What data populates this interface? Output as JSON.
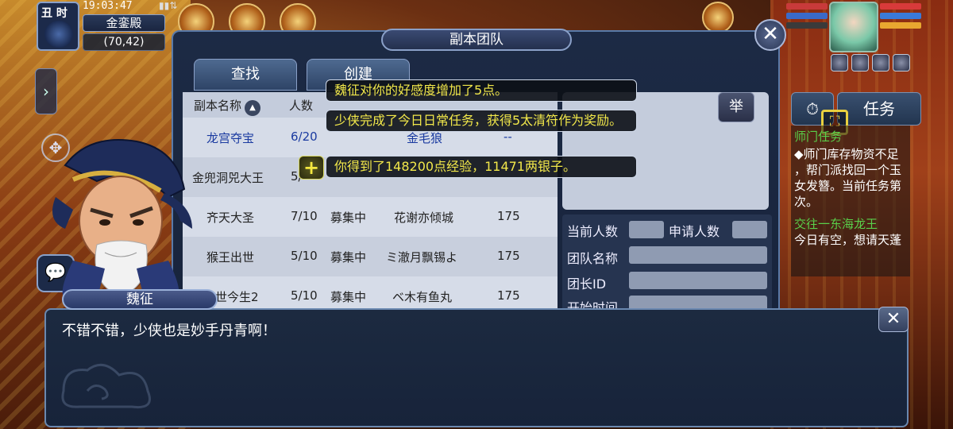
{
  "status": {
    "shichen": "丑 时",
    "clock": "19:03:47",
    "map_name": "金銮殿",
    "coords": "(70,42)"
  },
  "panel": {
    "title": "副本团队",
    "close": "✕",
    "tabs": [
      "查找",
      "创建"
    ],
    "raise_label": "举"
  },
  "table": {
    "headers": [
      "副本名称",
      "人数"
    ],
    "rows": [
      {
        "name": "龙宫夺宝",
        "count": "6/20",
        "status": "",
        "leader": "金毛狼",
        "level": "--"
      },
      {
        "name": "金兜洞兕大王",
        "count": "5/",
        "status": "",
        "leader": "",
        "level": ""
      },
      {
        "name": "齐天大圣",
        "count": "7/10",
        "status": "募集中",
        "leader": "花谢亦倾城",
        "level": "175"
      },
      {
        "name": "猴王出世",
        "count": "5/10",
        "status": "募集中",
        "leader": "ミ澈月飘锡よ",
        "level": "175"
      },
      {
        "name": "前世今生2",
        "count": "5/10",
        "status": "募集中",
        "leader": "ベ木有鱼丸",
        "level": "175"
      }
    ]
  },
  "info": {
    "current_count": "当前人数",
    "apply_count": "申请人数",
    "team_name": "团队名称",
    "leader_id": "团长ID",
    "start_time": "开始时间"
  },
  "notifications": [
    "魏征对你的好感度增加了5点。",
    "少侠完成了今日日常任务，获得5太清符作为奖励。",
    "你得到了148200点经验，11471两银子。"
  ],
  "task": {
    "task_tab": "任务",
    "lines": [
      {
        "text": "师门任务",
        "color": "#5ad04a"
      },
      {
        "text": "◆师门库存物资不足",
        "color": "#ffffff"
      },
      {
        "text": "，帮门派找回一个玉",
        "color": "#ffffff"
      },
      {
        "text": "女发簪。当前任务第",
        "color": "#ffffff"
      },
      {
        "text": "次。",
        "color": "#ffffff"
      },
      {
        "text": "交往一东海龙王",
        "color": "#5ad04a"
      },
      {
        "text": "今日有空，想请天蓬",
        "color": "#ffffff"
      }
    ]
  },
  "dialog": {
    "speaker": "魏征",
    "text": "不错不错，少侠也是妙手丹青啊！",
    "close": "✕"
  },
  "icons": {
    "side_arrow": "chevron-right-icon",
    "expand": "expand-arrows-icon",
    "chat": "chat-bubble-icon",
    "plus": "plus-icon",
    "fullscreen": "fullscreen-icon",
    "timer": "timer-icon"
  },
  "colors": {
    "panel_bg": "#1c2a45",
    "notif_text": "#f2e84a",
    "selected_row": "#1a3aa0",
    "task_green": "#5ad04a"
  }
}
